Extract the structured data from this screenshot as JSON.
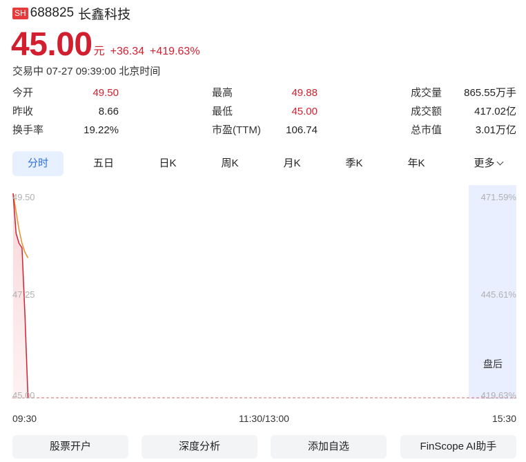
{
  "stock": {
    "market_badge": "SH",
    "code": "688825",
    "name": "长鑫科技",
    "price": "45.00",
    "unit": "元",
    "change": "+36.34",
    "change_pct": "+419.63%",
    "status": "交易中 07-27 09:39:00 北京时间"
  },
  "stats": [
    {
      "label": "今开",
      "value": "49.50",
      "color": "red"
    },
    {
      "label": "昨收",
      "value": "8.66",
      "color": "dark"
    },
    {
      "label": "换手率",
      "value": "19.22%",
      "color": "dark"
    },
    {
      "label": "最高",
      "value": "49.88",
      "color": "red"
    },
    {
      "label": "最低",
      "value": "45.00",
      "color": "red"
    },
    {
      "label": "市盈(TTM)",
      "value": "106.74",
      "color": "dark"
    },
    {
      "label": "成交量",
      "value": "865.55万手",
      "color": "dark"
    },
    {
      "label": "成交额",
      "value": "417.02亿",
      "color": "dark"
    },
    {
      "label": "总市值",
      "value": "3.01万亿",
      "color": "dark"
    }
  ],
  "tabs": [
    {
      "label": "分时",
      "active": true
    },
    {
      "label": "五日",
      "active": false
    },
    {
      "label": "日K",
      "active": false
    },
    {
      "label": "周K",
      "active": false
    },
    {
      "label": "月K",
      "active": false
    },
    {
      "label": "季K",
      "active": false
    },
    {
      "label": "年K",
      "active": false
    },
    {
      "label": "更多",
      "active": false
    }
  ],
  "chart": {
    "after_hours_label": "盘后",
    "y_left": [
      "49.50",
      "47.25",
      "45.00"
    ],
    "y_right": [
      "471.59%",
      "445.61%",
      "419.63%"
    ],
    "x_labels": [
      "09:30",
      "11:30/13:00",
      "15:30"
    ]
  },
  "chart_data": {
    "type": "line",
    "ylim": [
      45.0,
      49.5
    ],
    "series": [
      {
        "values": [
          49.5,
          48.62,
          48.4,
          48.3,
          46.8,
          45.0
        ]
      },
      {
        "values": [
          49.5,
          49.1,
          48.7,
          48.4,
          48.2,
          48.08
        ]
      }
    ],
    "reference_line": 45.0,
    "colors": {
      "price": "#d11f2f",
      "avg": "#f08a24",
      "reference": "#e06060"
    }
  },
  "actions": [
    {
      "label": "股票开户"
    },
    {
      "label": "深度分析"
    },
    {
      "label": "添加自选"
    },
    {
      "label": "FinScope AI助手"
    }
  ]
}
